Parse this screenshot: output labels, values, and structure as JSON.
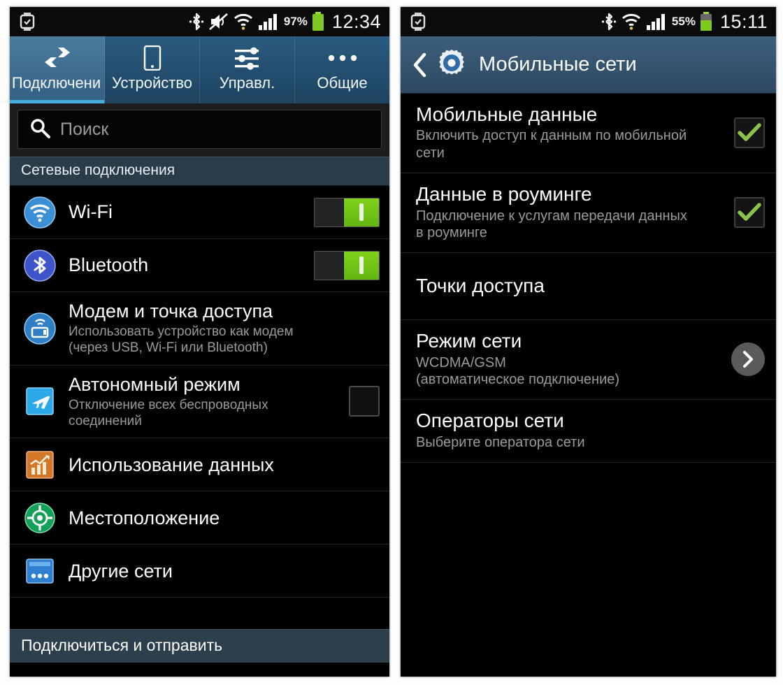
{
  "left_phone": {
    "statusbar": {
      "watch_icon": "watch-icon",
      "bluetooth_icon": "bluetooth-icon",
      "mute_icon": "sound-muted-icon",
      "wifi_icon": "wifi-icon",
      "signal_icon": "signal-bars-icon",
      "battery_percent": "97%",
      "battery_icon": "battery-icon",
      "clock": "12:34"
    },
    "tabs": [
      {
        "label": "Подключени",
        "icon": "connections-arrows-icon",
        "active": true
      },
      {
        "label": "Устройство",
        "icon": "phone-device-icon",
        "active": false
      },
      {
        "label": "Управл.",
        "icon": "sliders-icon",
        "active": false
      },
      {
        "label": "Общие",
        "icon": "ellipsis-icon",
        "active": false
      }
    ],
    "search": {
      "placeholder": "Поиск",
      "icon": "search-icon"
    },
    "section_header": "Сетевые подключения",
    "items": [
      {
        "title": "Wi-Fi",
        "subtitle": "",
        "icon": "wifi-circle-icon",
        "control": "toggle",
        "toggle_on": true
      },
      {
        "title": "Bluetooth",
        "subtitle": "",
        "icon": "bluetooth-circle-icon",
        "control": "toggle",
        "toggle_on": true
      },
      {
        "title": "Модем и точка доступа",
        "subtitle": "Использовать устройство как модем (через USB, Wi-Fi или Bluetooth)",
        "icon": "tethering-circle-icon",
        "control": "none",
        "toggle_on": false
      },
      {
        "title": "Автономный режим",
        "subtitle": "Отключение всех беспроводных соединений",
        "icon": "airplane-square-icon",
        "control": "checkbox",
        "checked": false
      },
      {
        "title": "Использование данных",
        "subtitle": "",
        "icon": "data-usage-chart-icon",
        "control": "none"
      },
      {
        "title": "Местоположение",
        "subtitle": "",
        "icon": "location-target-icon",
        "control": "none"
      },
      {
        "title": "Другие сети",
        "subtitle": "",
        "icon": "more-networks-icon",
        "control": "none"
      }
    ],
    "bottom_bar": "Подключиться и отправить"
  },
  "right_phone": {
    "statusbar": {
      "watch_icon": "watch-icon",
      "bluetooth_icon": "bluetooth-icon",
      "wifi_icon": "wifi-icon",
      "signal_icon": "signal-bars-icon",
      "battery_percent": "55%",
      "battery_icon": "battery-icon",
      "clock": "15:11"
    },
    "appbar": {
      "back_icon": "back-chevron-icon",
      "app_icon": "settings-gear-icon",
      "title": "Мобильные сети"
    },
    "items": [
      {
        "title": "Мобильные данные",
        "subtitle": "Включить доступ к данным по мобильной сети",
        "control": "checkbox",
        "checked": true
      },
      {
        "title": "Данные в роуминге",
        "subtitle": "Подключение к услугам передачи данных в роуминге",
        "control": "checkbox",
        "checked": true
      },
      {
        "title": "Точки доступа",
        "subtitle": "",
        "control": "none"
      },
      {
        "title": "Режим сети",
        "subtitle": "WCDMA/GSM\n(автоматическое подключение)",
        "control": "chevron"
      },
      {
        "title": "Операторы сети",
        "subtitle": "Выберите оператора сети",
        "control": "none"
      }
    ]
  },
  "colors": {
    "accent_blue": "#44aee0",
    "toggle_green": "#7fd31a",
    "check_green": "#8bc34a",
    "appbar_blue": "#3d5f7c",
    "section_blue": "#2b3c49",
    "background": "#000000"
  }
}
